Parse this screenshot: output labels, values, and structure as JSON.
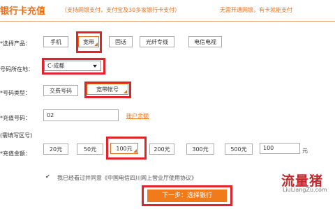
{
  "header": {
    "title": "银行卡充值",
    "subtitle": "（支持网银支付，支付宝及30多家银行卡支付）",
    "note": "无需开通网银，有卡就能支付"
  },
  "product": {
    "label": "*选择产品：",
    "options": [
      "手机",
      "宽带",
      "固话",
      "光纤专线",
      "电信电视"
    ],
    "selected": "宽带"
  },
  "region": {
    "label": "号码所在地：",
    "value": "C-成都"
  },
  "number_type": {
    "label": "*号码类型：",
    "options": [
      "交费号码",
      "宽带帐号"
    ],
    "selected": "宽带帐号"
  },
  "recharge_number": {
    "label": "*充值号码：",
    "value": "02",
    "link": "账户余额"
  },
  "area_code_note": "(需填写区号)",
  "amount": {
    "label": "*充值金额：",
    "options": [
      "20元",
      "50元",
      "100元",
      "200元",
      "300元",
      "500元"
    ],
    "selected": "100元",
    "custom_value": "100",
    "unit": "元"
  },
  "agreement": {
    "text": "我已经看过并同意《中国电信四川网上营业厅使用协议》",
    "checked": true
  },
  "submit_label": "下一步：选择银行",
  "watermark": {
    "cn": "流量猪",
    "en": "LiuLiangZu.com"
  },
  "colors": {
    "accent": "#e8701a",
    "highlight": "#e0242c"
  }
}
